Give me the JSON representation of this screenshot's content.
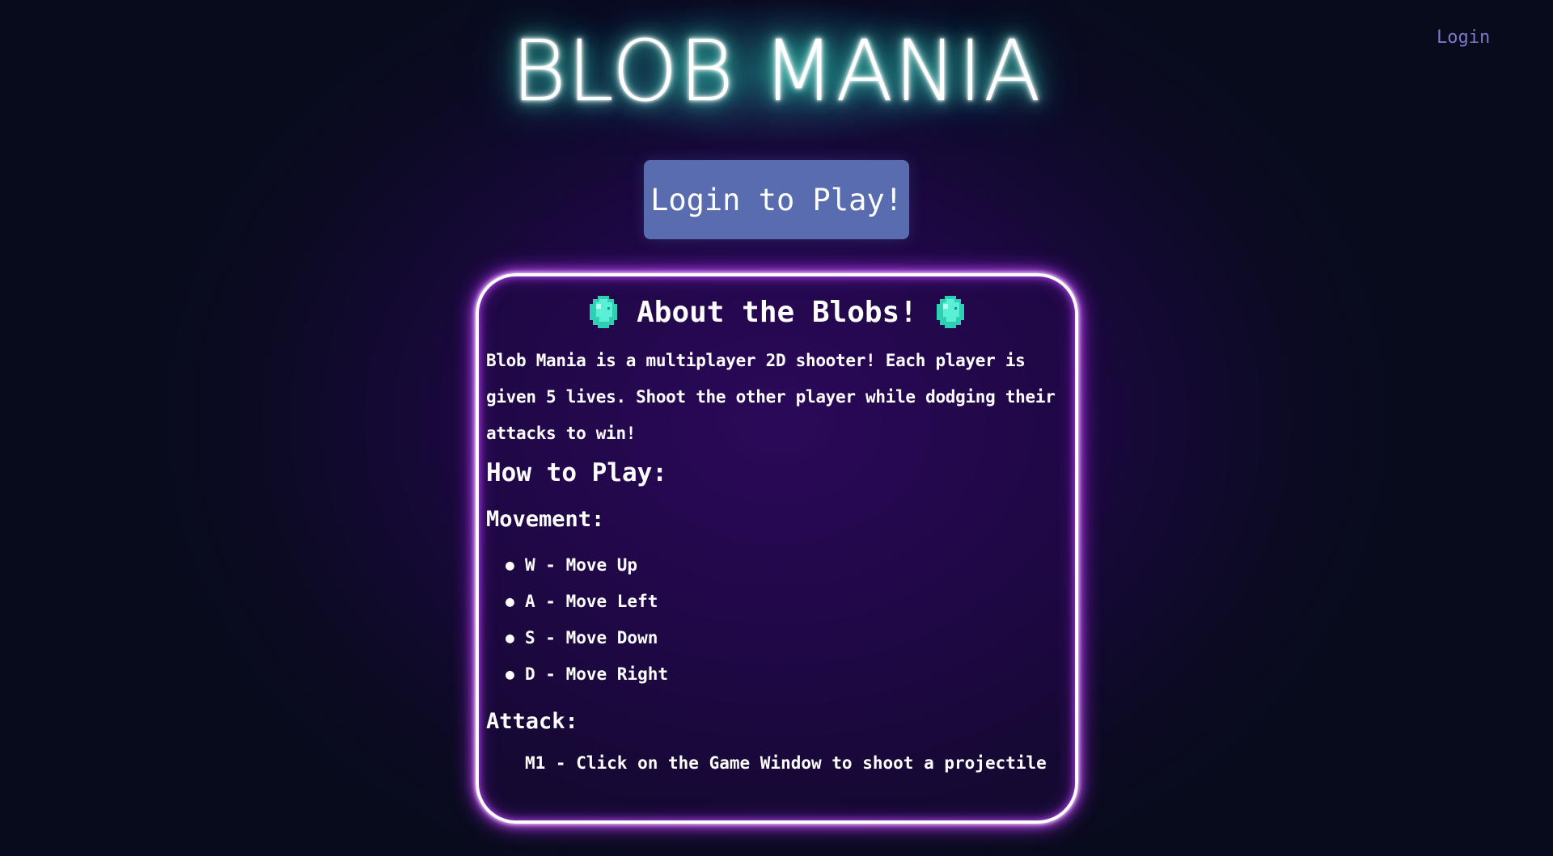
{
  "header": {
    "login_link": "Login",
    "title": "BLOB MANIA"
  },
  "play_button": {
    "label": "Login to Play!"
  },
  "about": {
    "heading": "About the Blobs!",
    "heading_icon": "blob-icon",
    "intro": "Blob Mania is a multiplayer 2D shooter! Each player is given 5 lives. Shoot the other player while dodging their attacks to win!",
    "how_to_play": "How to Play:",
    "movement_heading": "Movement:",
    "movement_items": [
      "W - Move Up",
      "A - Move Left",
      "S - Move Down",
      "D - Move Right"
    ],
    "attack_heading": "Attack:",
    "attack_text": "M1 - Click on the Game Window to shoot a projectile"
  },
  "colors": {
    "title_glow": "#24c9b0",
    "card_glow": "#b32cff",
    "button_bg": "#5a6cb0",
    "login_link": "#7b78c8",
    "blob_icon": "#3fe6c6"
  }
}
